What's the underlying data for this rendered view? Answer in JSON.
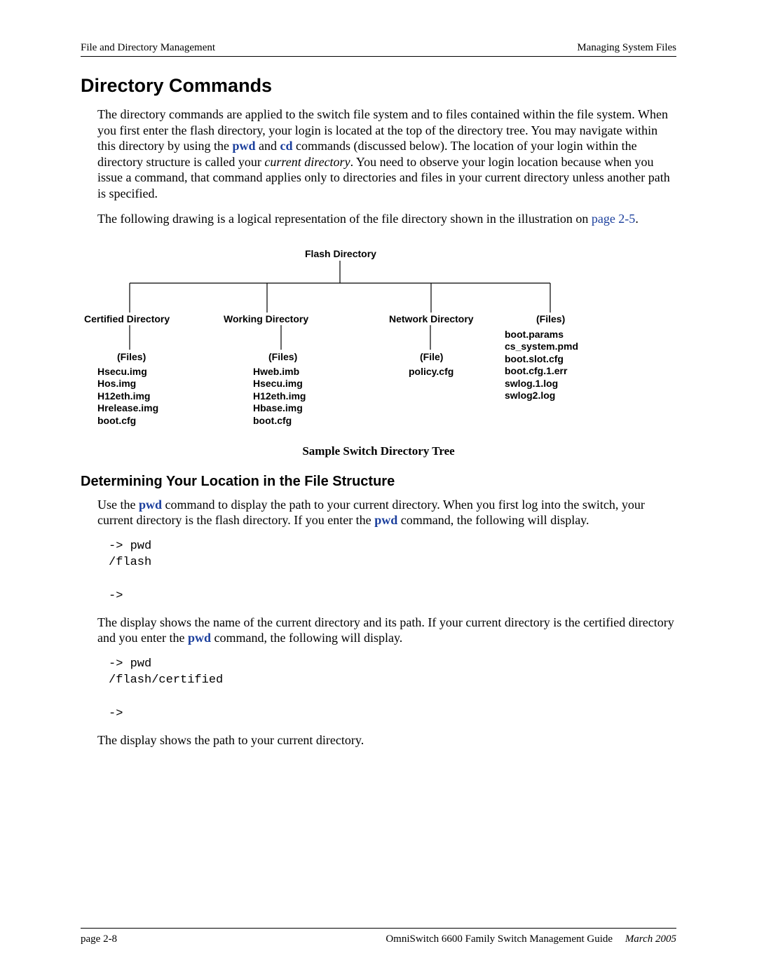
{
  "header": {
    "left": "File and Directory Management",
    "right": "Managing System Files"
  },
  "title": "Directory Commands",
  "para1_a": "The directory commands are applied to the switch file system and to files contained within the file system. When you first enter the flash directory, your login is located at the top of the directory tree. You may navigate within this directory by using the ",
  "para1_pwd": "pwd",
  "para1_b": " and ",
  "para1_cd": "cd",
  "para1_c": " commands (discussed below). The location of your login within the directory structure is called your ",
  "para1_italic": "current directory",
  "para1_d": ". You need to observe your login location because when you issue a command, that command applies only to directories and files in your current directory unless another path is specified.",
  "para2_a": "The following drawing is a logical representation of the file directory shown in the illustration on ",
  "para2_link": "page 2-5",
  "para2_b": ".",
  "diagram": {
    "flash": "Flash Directory",
    "certified": "Certified Directory",
    "working": "Working Directory",
    "network": "Network Directory",
    "files_root": "(Files)",
    "files_cert_label": "(Files)",
    "files_work_label": "(Files)",
    "file_net_label": "(File)",
    "files_root_list": "boot.params\ncs_system.pmd\nboot.slot.cfg\nboot.cfg.1.err\nswlog.1.log\nswlog2.log",
    "files_cert_list": "Hsecu.img\nHos.img\nH12eth.img\nHrelease.img\nboot.cfg",
    "files_work_list": "Hweb.imb\nHsecu.img\nH12eth.img\nHbase.img\nboot.cfg",
    "file_net_list": "policy.cfg"
  },
  "caption": "Sample Switch Directory Tree",
  "subheading": "Determining Your Location in the File Structure",
  "para3_a": "Use the ",
  "para3_pwd": "pwd",
  "para3_b": " command to display the path to your current directory. When you first log into the switch, your current directory is the flash directory. If you enter the ",
  "para3_pwd2": "pwd",
  "para3_c": " command, the following will display.",
  "code1": "-> pwd\n/flash\n\n->",
  "para4_a": "The display shows the name of the current directory and its path. If your current directory is the certified directory and you enter the ",
  "para4_pwd": "pwd",
  "para4_b": " command, the following will display.",
  "code2": "-> pwd\n/flash/certified\n\n->",
  "para5": "The display shows the path to your current directory.",
  "footer": {
    "page": "page 2-8",
    "guide": "OmniSwitch 6600 Family Switch Management Guide",
    "date": "March 2005"
  }
}
